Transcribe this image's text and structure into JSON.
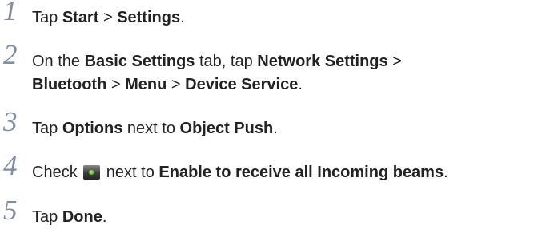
{
  "steps": [
    {
      "number": "1",
      "parts": [
        "Tap ",
        "Start",
        " > ",
        "Settings",
        "."
      ]
    },
    {
      "number": "2",
      "line1": [
        "On the ",
        "Basic Settings",
        " tab, tap ",
        "Network Settings",
        " >"
      ],
      "line2": [
        "Bluetooth",
        " > ",
        "Menu",
        " > ",
        "Device Service",
        "."
      ]
    },
    {
      "number": "3",
      "parts": [
        "Tap ",
        "Options",
        " next to ",
        "Object Push",
        "."
      ]
    },
    {
      "number": "4",
      "before_icon": "Check ",
      "icon": "checkbox-icon",
      "after_icon": [
        " next to ",
        "Enable to receive all Incoming beams",
        "."
      ]
    },
    {
      "number": "5",
      "parts": [
        "Tap ",
        "Done",
        "."
      ]
    }
  ]
}
